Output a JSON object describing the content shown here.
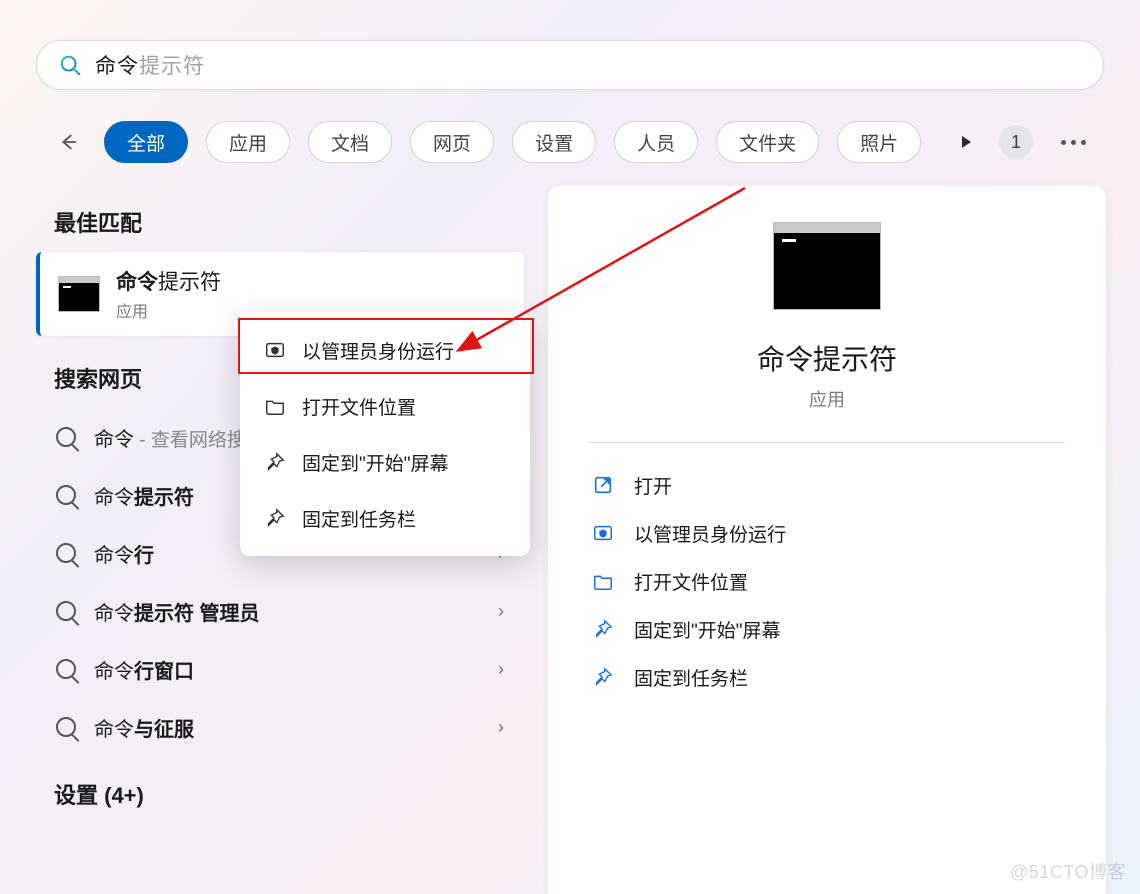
{
  "search": {
    "query_bold": "命令",
    "query_rest": "提示符"
  },
  "filters": {
    "items": [
      "全部",
      "应用",
      "文档",
      "网页",
      "设置",
      "人员",
      "文件夹",
      "照片"
    ],
    "active_index": 0,
    "count_badge": "1"
  },
  "left": {
    "best_match_header": "最佳匹配",
    "best_match": {
      "title_bold": "命令",
      "title_rest": "提示符",
      "subtitle": "应用"
    },
    "search_web_header": "搜索网页",
    "web_items": [
      {
        "pre": "命令",
        "bold": "",
        "post": "",
        "hint": " - 查看网络搜"
      },
      {
        "pre": "命令",
        "bold": "提示符",
        "post": "",
        "hint": ""
      },
      {
        "pre": "命令",
        "bold": "行",
        "post": "",
        "hint": ""
      },
      {
        "pre": "命令",
        "bold": "提示符 管理员",
        "post": "",
        "hint": ""
      },
      {
        "pre": "命令",
        "bold": "行窗口",
        "post": "",
        "hint": ""
      },
      {
        "pre": "命令",
        "bold": "与征服",
        "post": "",
        "hint": ""
      }
    ],
    "settings_header": "设置 (4+)"
  },
  "context_menu": {
    "items": [
      "以管理员身份运行",
      "打开文件位置",
      "固定到\"开始\"屏幕",
      "固定到任务栏"
    ]
  },
  "right": {
    "title": "命令提示符",
    "subtitle": "应用",
    "actions": [
      "打开",
      "以管理员身份运行",
      "打开文件位置",
      "固定到\"开始\"屏幕",
      "固定到任务栏"
    ]
  },
  "watermark": "@51CTO博客"
}
